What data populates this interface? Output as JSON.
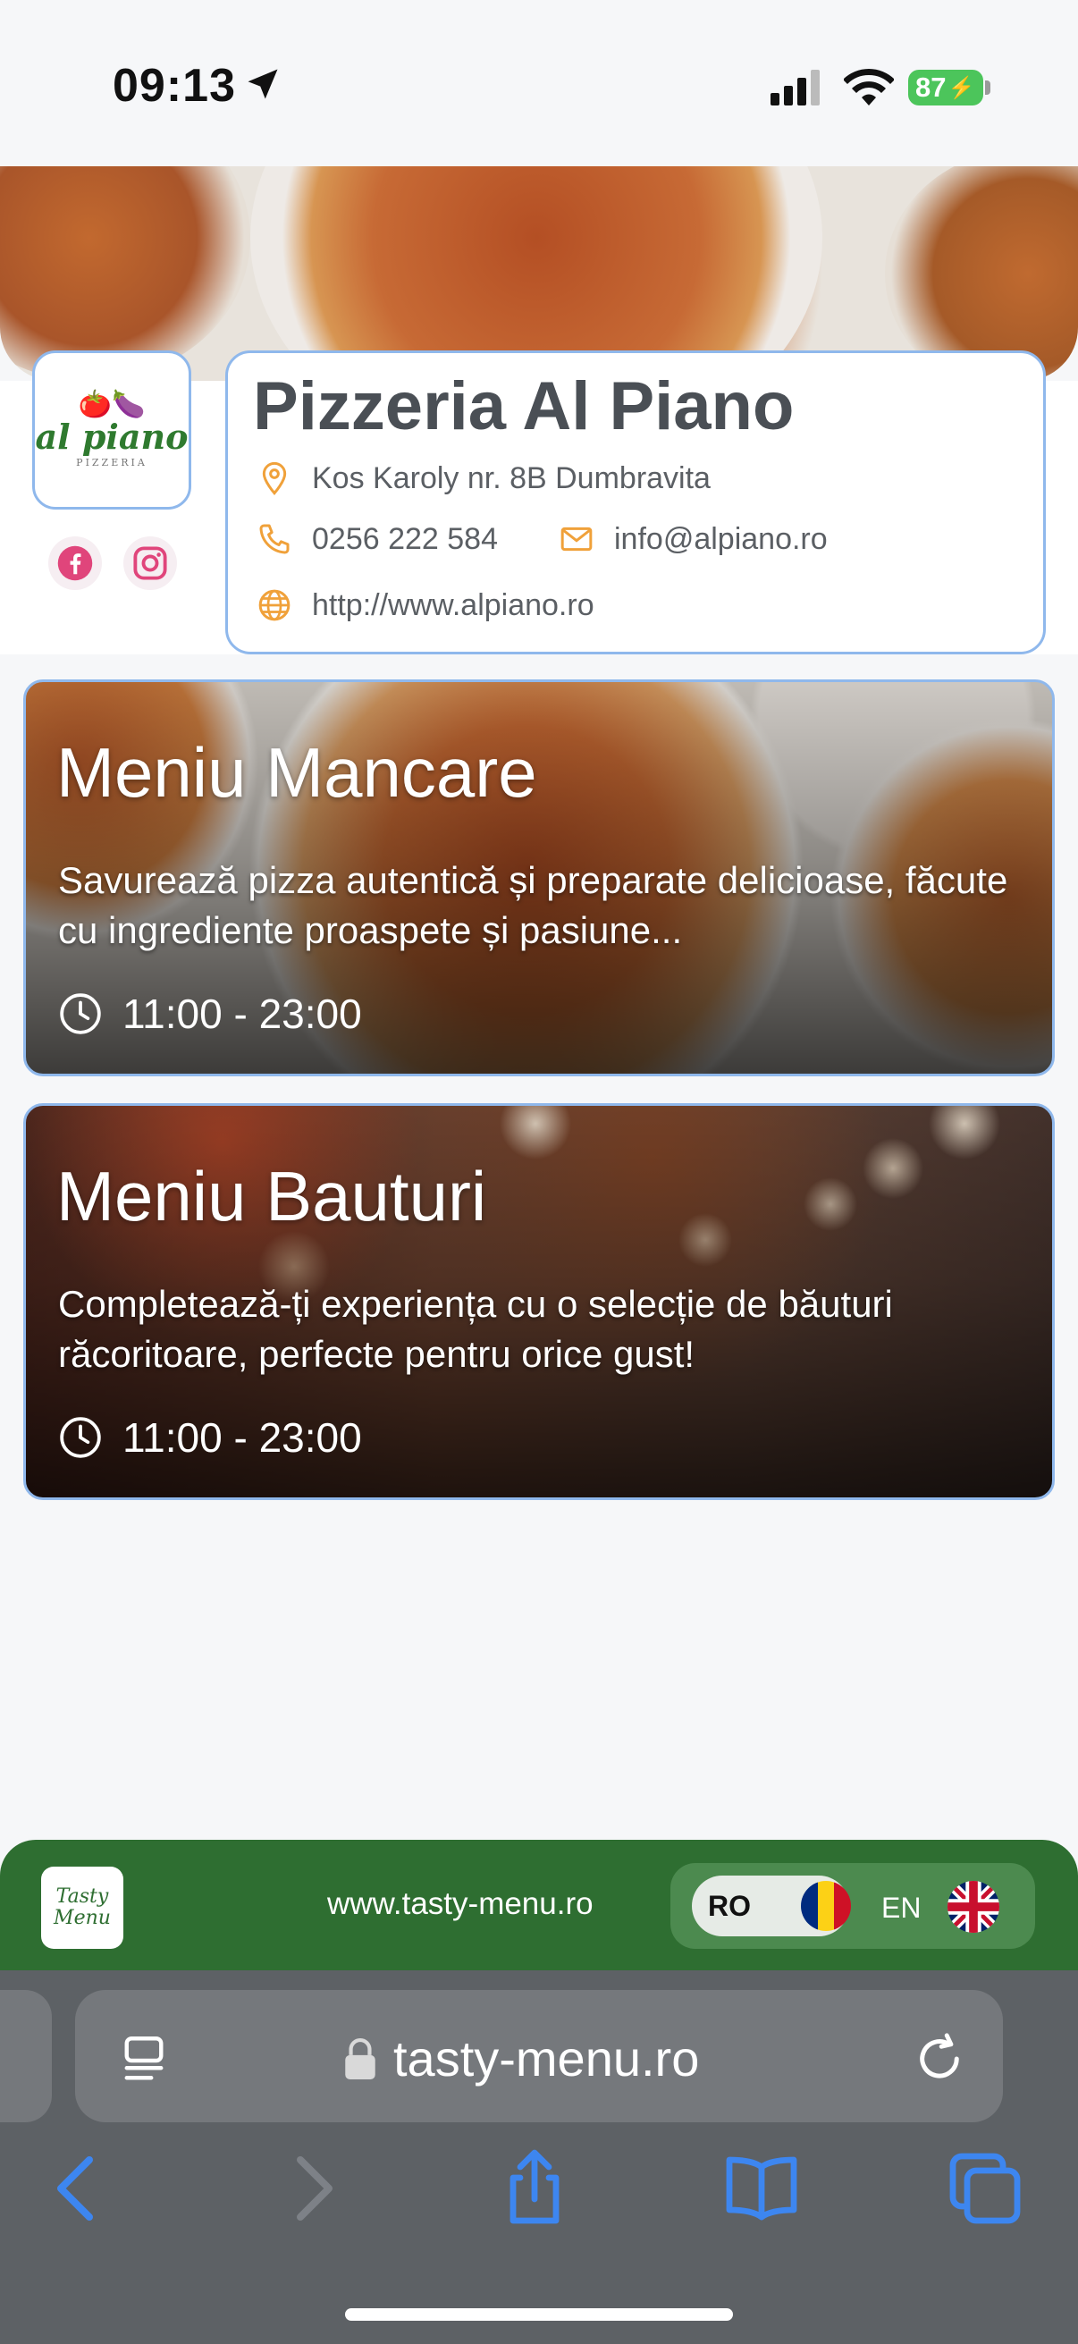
{
  "status_bar": {
    "time": "09:13",
    "battery": "87"
  },
  "restaurant": {
    "name": "Pizzeria Al Piano",
    "address": "Kos Karoly nr. 8B Dumbravita",
    "phone": "0256 222 584",
    "email": "info@alpiano.ro",
    "website": "http://www.alpiano.ro",
    "logo": {
      "name": "al piano",
      "sub": "PIZZERIA"
    }
  },
  "menus": [
    {
      "title": "Meniu Mancare",
      "description": "Savurează pizza autentică și preparate delicioase, făcute cu ingrediente proaspete și pasiune...",
      "hours": "11:00 - 23:00"
    },
    {
      "title": "Meniu Bauturi",
      "description": "Completează-ți experiența cu o selecție de băuturi răcoritoare, perfecte pentru orice gust!",
      "hours": "11:00 - 23:00"
    }
  ],
  "footer": {
    "logo_line1": "Tasty",
    "logo_line2": "Menu",
    "url": "www.tasty-menu.ro",
    "lang_ro": "RO",
    "lang_en": "EN"
  },
  "browser": {
    "address": "tasty-menu.ro"
  },
  "colors": {
    "accent_border": "#8fb8ec",
    "footer_green": "#2e6e31",
    "icon_orange": "#f0a13a",
    "social_pink": "#e0457b"
  }
}
